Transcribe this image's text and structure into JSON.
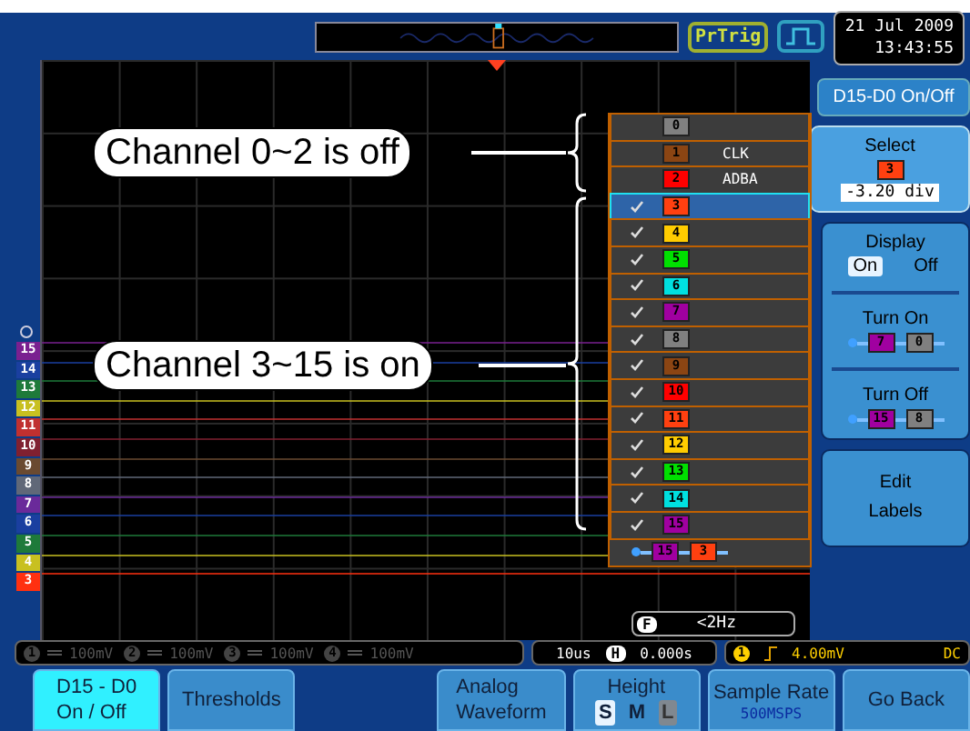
{
  "top_bar": {
    "trigger_status": "PrTrig",
    "date": "21 Jul 2009",
    "time": "13:43:55"
  },
  "callouts": [
    {
      "text": "Channel 0~2 is off"
    },
    {
      "text": "Channel 3~15 is on"
    }
  ],
  "channels": [
    {
      "label": "0",
      "color": "#808080",
      "checked": false,
      "selected": false
    },
    {
      "label": "1",
      "color": "#8b4513",
      "name": "CLK",
      "checked": false,
      "selected": false
    },
    {
      "label": "2",
      "color": "#ff0000",
      "name": "ADBA",
      "checked": false,
      "selected": false
    },
    {
      "label": "3",
      "color": "#ff4010",
      "checked": true,
      "selected": true
    },
    {
      "label": "4",
      "color": "#ffcc00",
      "checked": true,
      "selected": false
    },
    {
      "label": "5",
      "color": "#00e000",
      "checked": true,
      "selected": false
    },
    {
      "label": "6",
      "color": "#00e0e0",
      "checked": true,
      "selected": false
    },
    {
      "label": "7",
      "color": "#a000a0",
      "checked": true,
      "selected": false
    },
    {
      "label": "8",
      "color": "#808080",
      "checked": true,
      "selected": false
    },
    {
      "label": "9",
      "color": "#8b4513",
      "checked": true,
      "selected": false
    },
    {
      "label": "10",
      "color": "#ff0000",
      "checked": true,
      "selected": false
    },
    {
      "label": "11",
      "color": "#ff4010",
      "checked": true,
      "selected": false
    },
    {
      "label": "12",
      "color": "#ffcc00",
      "checked": true,
      "selected": false
    },
    {
      "label": "13",
      "color": "#00e000",
      "checked": true,
      "selected": false
    },
    {
      "label": "14",
      "color": "#00e0e0",
      "checked": true,
      "selected": false
    },
    {
      "label": "15",
      "color": "#a000a0",
      "checked": true,
      "selected": false
    }
  ],
  "channel_range": {
    "from": {
      "label": "15",
      "color": "#a000a0"
    },
    "to": {
      "label": "3",
      "color": "#ff4010"
    }
  },
  "markers": [
    {
      "label": "15",
      "color": "#7a2090"
    },
    {
      "label": "14",
      "color": "#1a3fa0"
    },
    {
      "label": "13",
      "color": "#1e7a3a"
    },
    {
      "label": "12",
      "color": "#c8c020"
    },
    {
      "label": "11",
      "color": "#c03030"
    },
    {
      "label": "10",
      "color": "#802030"
    },
    {
      "label": "9",
      "color": "#6a4a30"
    },
    {
      "label": "8",
      "color": "#606878"
    },
    {
      "label": "7",
      "color": "#6a2a9a"
    },
    {
      "label": "6",
      "color": "#1a3fa0"
    },
    {
      "label": "5",
      "color": "#1e7a3a"
    },
    {
      "label": "4",
      "color": "#c8c020"
    },
    {
      "label": "3",
      "color": "#ff3010"
    }
  ],
  "frequency": {
    "icon": "F",
    "value": "<2Hz"
  },
  "status_bar": {
    "channels": [
      {
        "number": "1",
        "scale": "100mV",
        "enabled": false
      },
      {
        "number": "2",
        "scale": "100mV",
        "enabled": false
      },
      {
        "number": "3",
        "scale": "100mV",
        "enabled": false
      },
      {
        "number": "4",
        "scale": "100mV",
        "enabled": false
      }
    ],
    "timebase": "10us",
    "position_icon": "H",
    "position": "0.000s",
    "trigger_source": "1",
    "trigger_level": "4.00mV",
    "coupling": "DC"
  },
  "menu": {
    "title": "D15-D0 On/Off",
    "select": {
      "label": "Select",
      "tag": {
        "label": "3",
        "color": "#ff4010"
      },
      "value": "-3.20 div"
    },
    "display": {
      "label": "Display",
      "options": [
        {
          "label": "On",
          "selected": true
        },
        {
          "label": "Off",
          "selected": false
        }
      ]
    },
    "turn_on": {
      "label": "Turn On",
      "from": {
        "label": "7",
        "color": "#a000a0"
      },
      "to": {
        "label": "0",
        "color": "#808080"
      }
    },
    "turn_off": {
      "label": "Turn Off",
      "from": {
        "label": "15",
        "color": "#a000a0"
      },
      "to": {
        "label": "8",
        "color": "#808080"
      }
    },
    "edit_labels": [
      "Edit",
      "Labels"
    ]
  },
  "soft_keys": [
    {
      "kind": "plain",
      "lines": [
        "D15 - D0",
        "On / Off"
      ],
      "selected": true
    },
    {
      "kind": "plain",
      "lines": [
        "Thresholds"
      ],
      "selected": false
    },
    {
      "kind": "plain",
      "lines": [
        "Analog",
        "Waveform"
      ],
      "selected": false
    },
    {
      "kind": "options",
      "lines": [
        "Height"
      ],
      "selected": false,
      "options": [
        {
          "label": "S",
          "selected": true,
          "disabled": false
        },
        {
          "label": "M",
          "selected": false,
          "disabled": false
        },
        {
          "label": "L",
          "selected": false,
          "disabled": true
        }
      ]
    },
    {
      "kind": "value",
      "lines": [
        "Sample Rate"
      ],
      "value": "500MSPS",
      "selected": false
    },
    {
      "kind": "plain",
      "lines": [
        "Go Back"
      ],
      "selected": false
    }
  ]
}
